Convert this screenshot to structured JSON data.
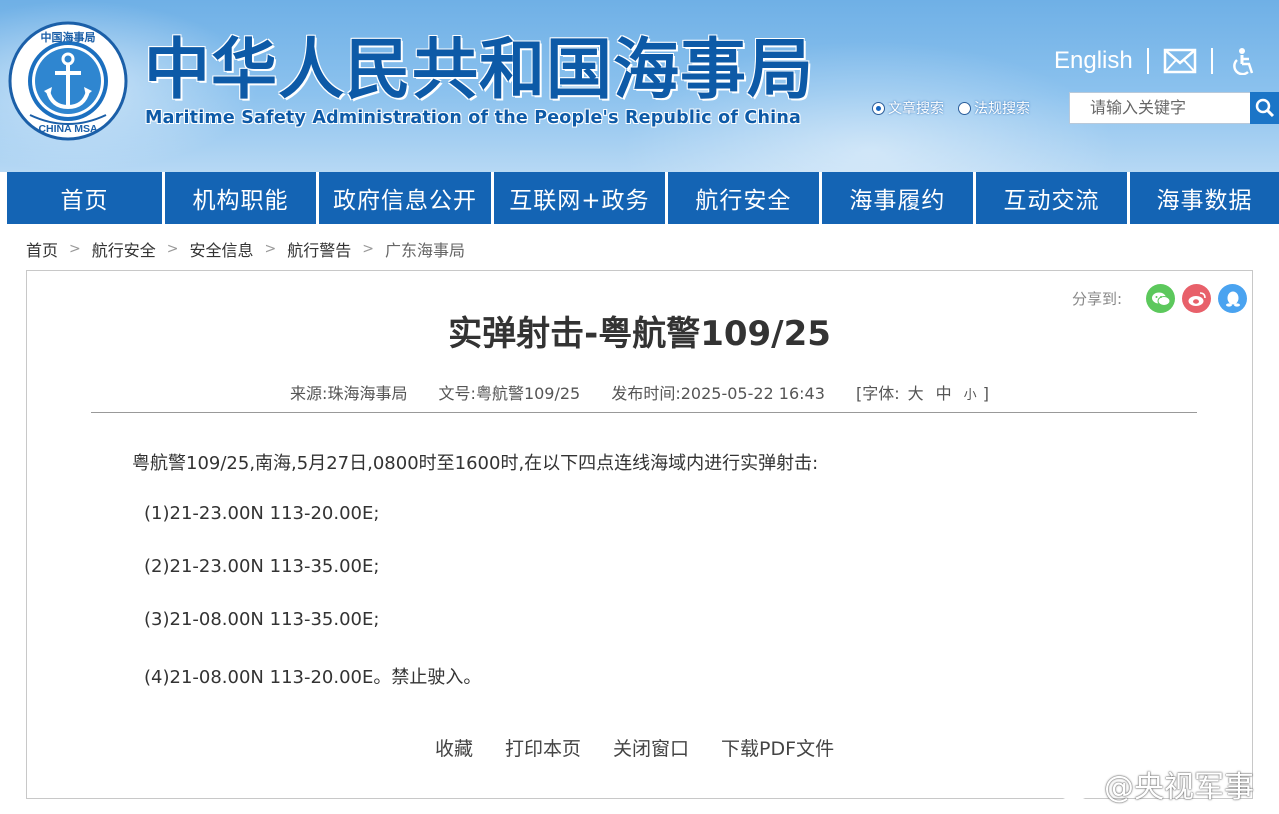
{
  "header": {
    "title": "中华人民共和国海事局",
    "subtitle": "Maritime Safety Administration of the People's Republic of China",
    "emblem_top_text": "中国海事局",
    "emblem_bottom_text": "CHINA MSA",
    "english_link": "English",
    "search_options": [
      {
        "label": "文章搜索",
        "selected": true
      },
      {
        "label": "法规搜索",
        "selected": false
      }
    ],
    "search_placeholder": "请输入关键字"
  },
  "nav": {
    "items": [
      "首页",
      "机构职能",
      "政府信息公开",
      "互联网+政务",
      "航行安全",
      "海事履约",
      "互动交流",
      "海事数据"
    ]
  },
  "breadcrumb": [
    "首页",
    "航行安全",
    "安全信息",
    "航行警告",
    "广东海事局"
  ],
  "share": {
    "label": "分享到:",
    "icons": [
      "wechat-icon",
      "weibo-icon",
      "qq-icon"
    ]
  },
  "article": {
    "title": "实弹射击-粤航警109/25",
    "meta": {
      "source": "来源:珠海海事局",
      "doc_no": "文号:粤航警109/25",
      "published": "发布时间:2025-05-22 16:43",
      "font_label": "[字体:",
      "font_large": "大",
      "font_medium": "中",
      "font_small": "小",
      "font_close": "]"
    },
    "intro": "粤航警109/25,南海,5月27日,0800时至1600时,在以下四点连线海域内进行实弹射击:",
    "points": [
      "(1)21-23.00N 113-20.00E;",
      "(2)21-23.00N 113-35.00E;",
      "(3)21-08.00N 113-35.00E;",
      "(4)21-08.00N 113-20.00E。禁止驶入。"
    ]
  },
  "actions": [
    "收藏",
    "打印本页",
    "关闭窗口",
    "下载PDF文件"
  ],
  "watermark": "@央视军事",
  "colors": {
    "nav_bg": "#1464b4",
    "title_blue": "#0d5aa7",
    "wechat": "#5cc85c",
    "weibo": "#e8606a",
    "qq": "#4aa3f0"
  }
}
